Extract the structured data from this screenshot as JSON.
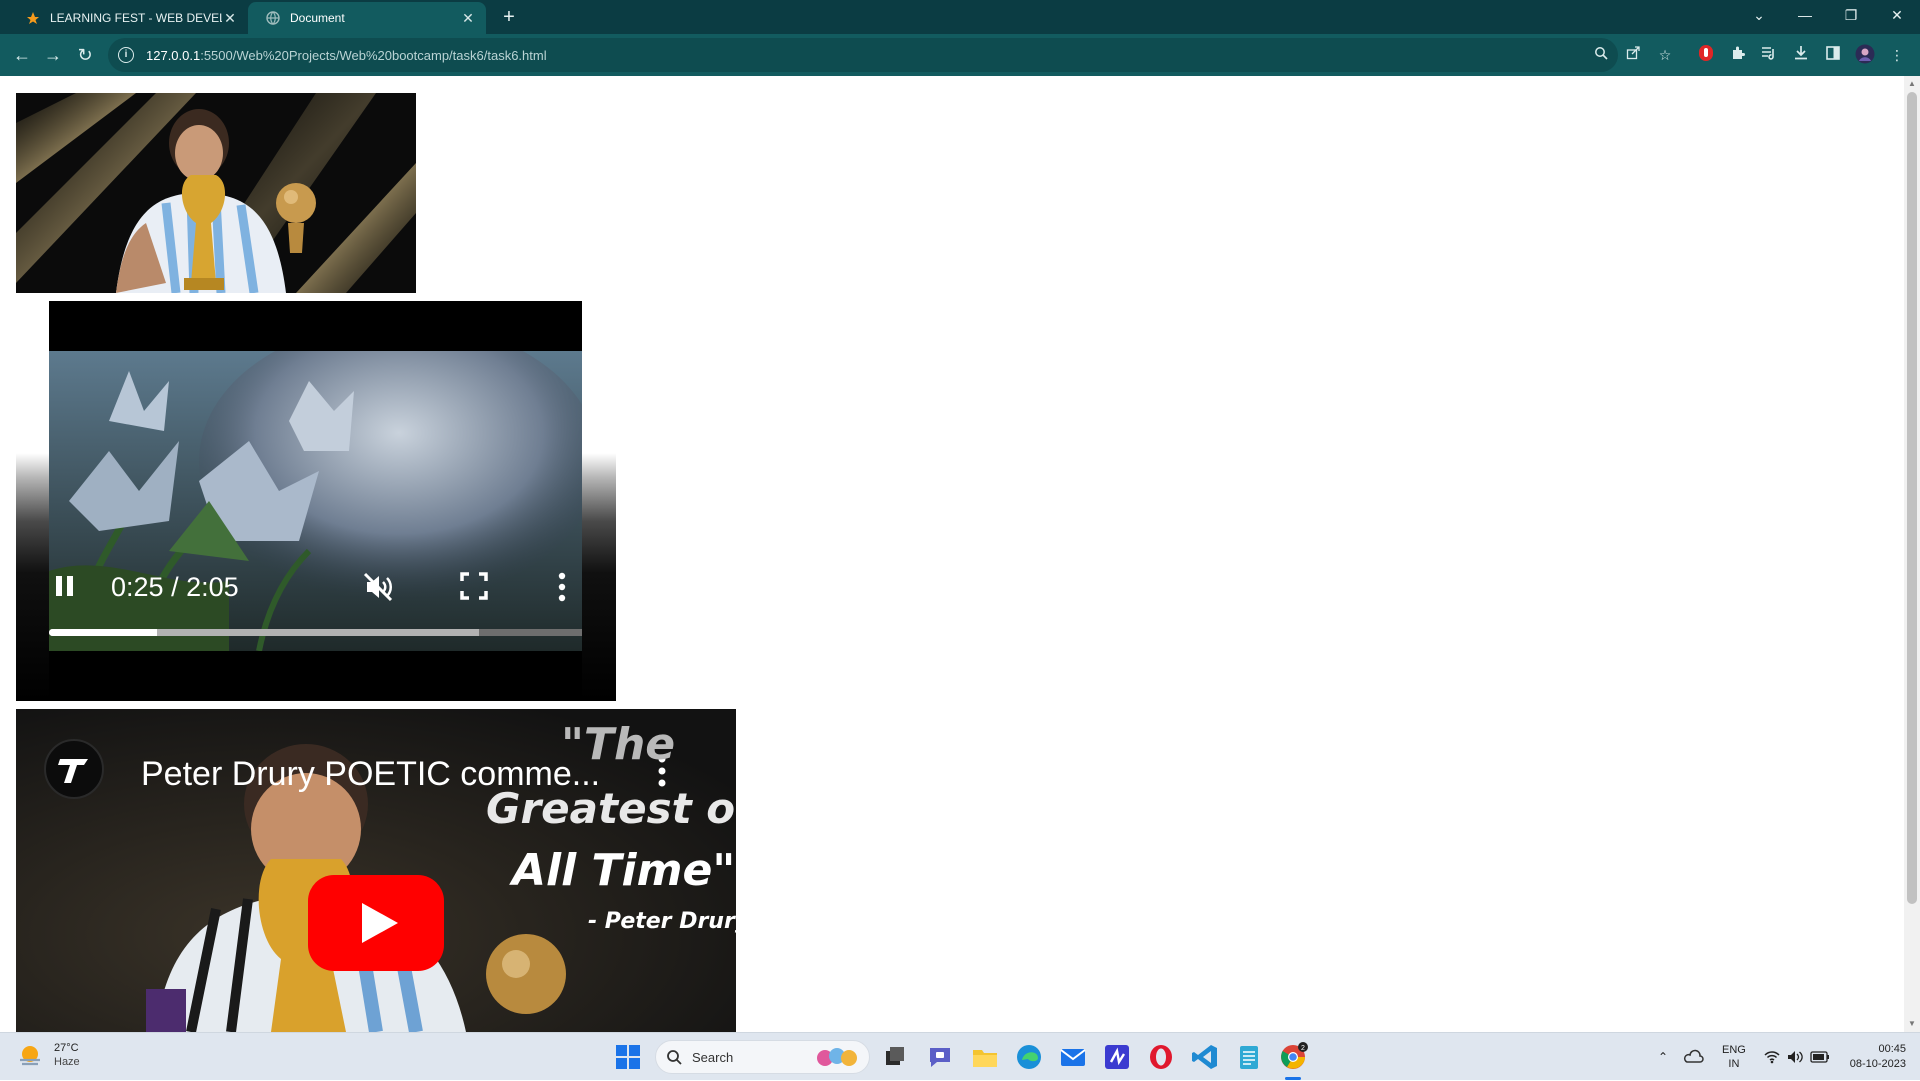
{
  "browser": {
    "tabs": [
      {
        "title": "LEARNING FEST - WEB DEVELOP",
        "active": false,
        "icon": "fest-favicon-icon"
      },
      {
        "title": "Document",
        "active": true,
        "icon": "globe-icon"
      }
    ],
    "url_host": "127.0.0.1",
    "url_path": ":5500/Web%20Projects/Web%20bootcamp/task6/task6.html",
    "colors": {
      "tabstrip": "#0b3c43",
      "toolbar": "#125b5f",
      "accent": "#ffffff"
    }
  },
  "page": {
    "video": {
      "current_time": "0:25",
      "duration": "2:05",
      "time_display": "0:25 / 2:05",
      "played_fraction": 0.2,
      "buffered_fraction": 0.8,
      "state": "playing",
      "muted": true
    },
    "youtube_embed": {
      "video_title": "Peter Drury POETIC comme...",
      "thumbnail_quote_line1": "\"The",
      "thumbnail_quote_line2": "Greatest of",
      "thumbnail_quote_line3": "All Time\"",
      "thumbnail_quote_attribution": "- Peter Drury",
      "play_button_color": "#ff0000"
    }
  },
  "taskbar": {
    "weather_temp": "27°C",
    "weather_condition": "Haze",
    "search_placeholder": "Search",
    "language_line1": "ENG",
    "language_line2": "IN",
    "time": "00:45",
    "date": "08-10-2023",
    "chrome_badge_count": "2"
  }
}
